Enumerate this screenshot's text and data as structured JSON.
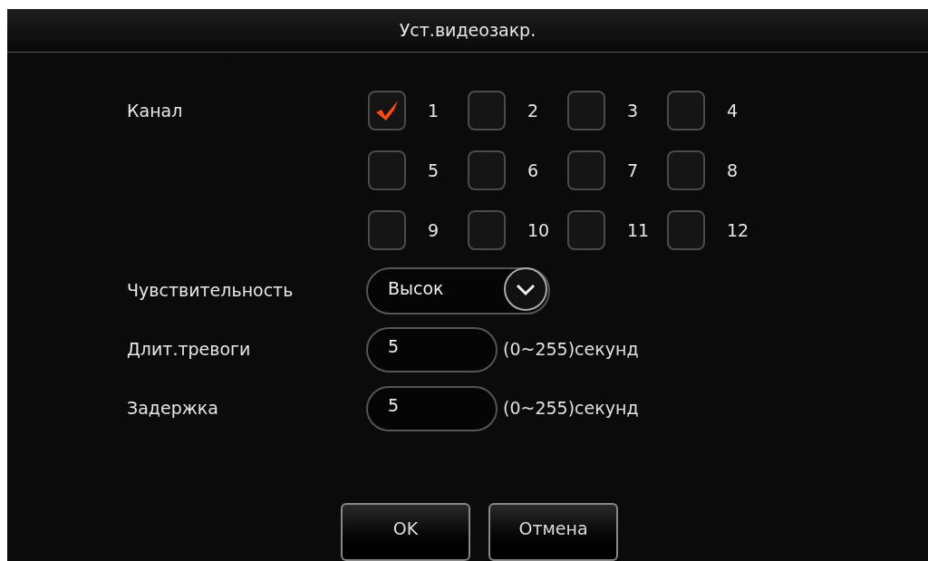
{
  "window": {
    "title": "Уст.видеозакр."
  },
  "channel": {
    "label": "Канал",
    "options": [
      {
        "number": "1",
        "checked": true
      },
      {
        "number": "2",
        "checked": false
      },
      {
        "number": "3",
        "checked": false
      },
      {
        "number": "4",
        "checked": false
      },
      {
        "number": "5",
        "checked": false
      },
      {
        "number": "6",
        "checked": false
      },
      {
        "number": "7",
        "checked": false
      },
      {
        "number": "8",
        "checked": false
      },
      {
        "number": "9",
        "checked": false
      },
      {
        "number": "10",
        "checked": false
      },
      {
        "number": "11",
        "checked": false
      },
      {
        "number": "12",
        "checked": false
      }
    ]
  },
  "sensitivity": {
    "label": "Чувствительность",
    "value": "Высок"
  },
  "alarm_duration": {
    "label": "Длит.тревоги",
    "value": "5",
    "hint": "(0~255)секунд"
  },
  "delay": {
    "label": "Задержка",
    "value": "5",
    "hint": "(0~255)секунд"
  },
  "buttons": [
    "OK",
    "Отмена"
  ]
}
